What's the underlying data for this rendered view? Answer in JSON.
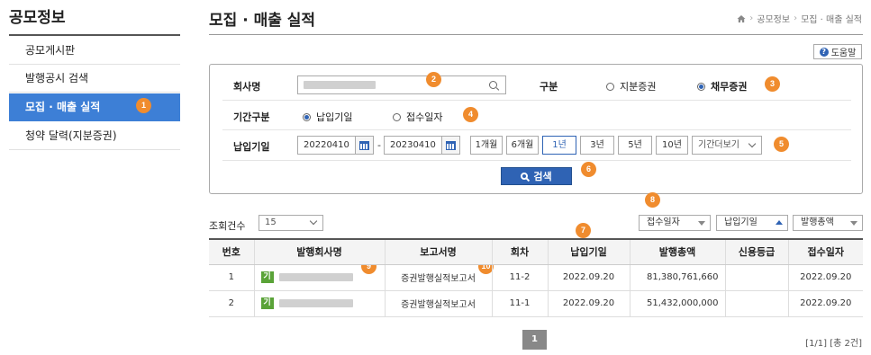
{
  "sidebar": {
    "title": "공모정보",
    "items": [
      {
        "label": "공모게시판"
      },
      {
        "label": "발행공시 검색"
      },
      {
        "label": "모집 · 매출 실적"
      },
      {
        "label": "청약 달력(지분증권)"
      }
    ]
  },
  "header": {
    "title": "모집 · 매출 실적",
    "breadcrumb": [
      "공모정보",
      "모집 · 매출 실적"
    ],
    "help_label": "도움말"
  },
  "search": {
    "company_label": "회사명",
    "type_label": "구분",
    "type_options": [
      {
        "label": "지분증권",
        "checked": false
      },
      {
        "label": "채무증권",
        "checked": true
      }
    ],
    "period_type_label": "기간구분",
    "period_type_options": [
      {
        "label": "납입기일",
        "checked": true
      },
      {
        "label": "접수일자",
        "checked": false
      }
    ],
    "date_label": "납입기일",
    "date_from": "20220410",
    "date_sep": "-",
    "date_to": "20230410",
    "period_buttons": [
      "1개월",
      "6개월",
      "1년",
      "3년",
      "5년",
      "10년"
    ],
    "period_more": "기간더보기",
    "search_button": "검색"
  },
  "results": {
    "count_label": "조회건수",
    "count_value": "15",
    "sort_buttons": [
      "접수일자",
      "납입기일",
      "발행총액"
    ],
    "columns": [
      "번호",
      "발행회사명",
      "보고서명",
      "회차",
      "납입기일",
      "발행총액",
      "신용등급",
      "접수일자"
    ],
    "rows": [
      {
        "no": "1",
        "tag": "기",
        "report": "증권발행실적보고서",
        "round": "11-2",
        "pay_date": "2022.09.20",
        "amount": "81,380,761,660",
        "rating": "",
        "receipt": "2022.09.20"
      },
      {
        "no": "2",
        "tag": "기",
        "report": "증권발행실적보고서",
        "round": "11-1",
        "pay_date": "2022.09.20",
        "amount": "51,432,000,000",
        "rating": "",
        "receipt": "2022.09.20"
      }
    ],
    "page": "1",
    "page_info": "[1/1] [총 2건]"
  },
  "badges": [
    "1",
    "2",
    "3",
    "4",
    "5",
    "6",
    "7",
    "8",
    "9",
    "10"
  ],
  "colors": {
    "accent": "#3d7fd6",
    "button": "#2f63b4",
    "badge": "#f08c2e",
    "corp_tag": "#5aa338"
  }
}
